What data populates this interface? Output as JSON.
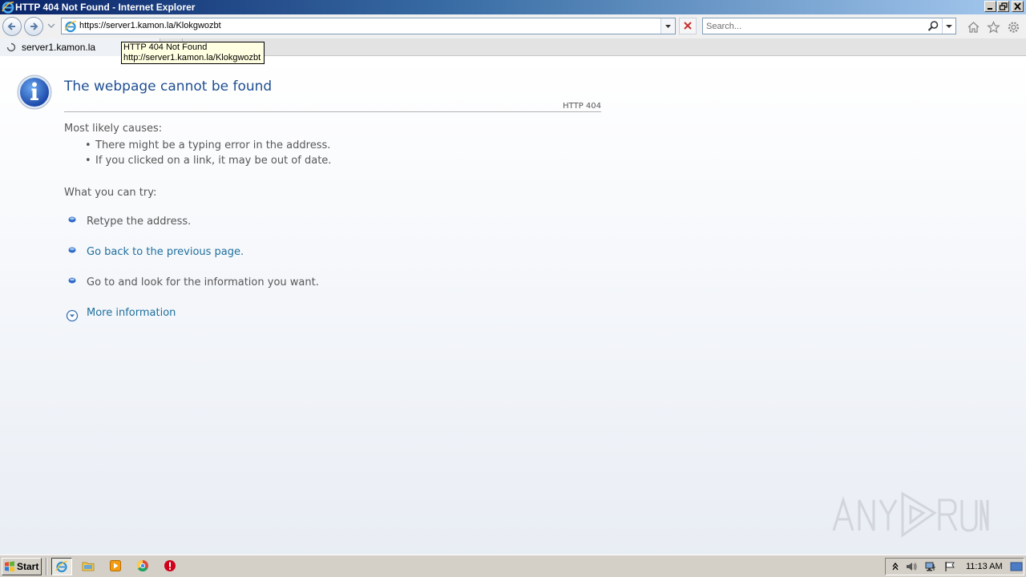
{
  "window": {
    "title": "HTTP 404 Not Found - Internet Explorer"
  },
  "address_bar": {
    "url": "https://server1.kamon.la/Klokgwozbt"
  },
  "search": {
    "placeholder": "Search..."
  },
  "tab": {
    "label": "server1.kamon.la"
  },
  "tooltip": {
    "line1": "HTTP 404 Not Found",
    "line2": "http://server1.kamon.la/Klokgwozbt"
  },
  "page": {
    "heading": "The webpage cannot be found",
    "code": "HTTP 404",
    "causes_title": "Most likely causes:",
    "causes": [
      "There might be a typing error in the address.",
      "If you clicked on a link, it may be out of date."
    ],
    "try_title": "What you can try:",
    "try": [
      "Retype the address.",
      "Go back to the previous page.",
      "Go to  and look for the information you want."
    ],
    "more_info": "More information"
  },
  "taskbar": {
    "start_label": "Start",
    "clock": "11:13 AM"
  },
  "icons": {
    "page_info": "info-icon",
    "back": "back-arrow-icon",
    "forward": "forward-arrow-icon",
    "stop": "close-icon",
    "search": "magnifier-icon",
    "home": "home-icon",
    "favorites": "star-icon",
    "tools": "gear-icon"
  },
  "colors": {
    "heading": "#1f4e92",
    "link": "#1f6f9e",
    "text": "#575757"
  }
}
